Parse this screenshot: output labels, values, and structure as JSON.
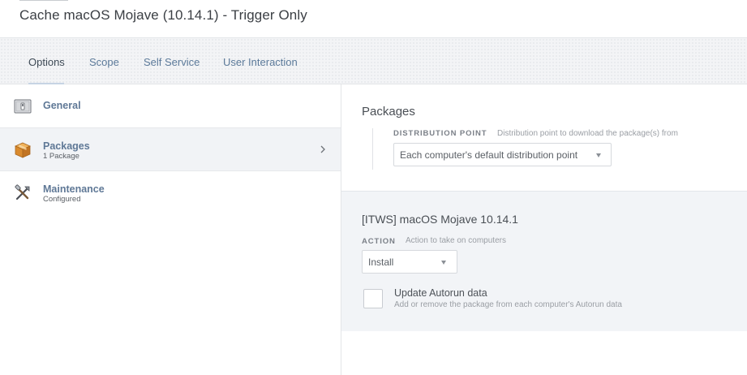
{
  "header": {
    "title": "Cache macOS Mojave (10.14.1) - Trigger Only"
  },
  "tabs": [
    {
      "label": "Options",
      "active": true
    },
    {
      "label": "Scope",
      "active": false
    },
    {
      "label": "Self Service",
      "active": false
    },
    {
      "label": "User Interaction",
      "active": false
    }
  ],
  "sidebar": {
    "items": [
      {
        "label": "General",
        "sublabel": "",
        "icon": "general-switch-icon"
      },
      {
        "label": "Packages",
        "sublabel": "1 Package",
        "icon": "package-box-icon",
        "selected": true
      },
      {
        "label": "Maintenance",
        "sublabel": "Configured",
        "icon": "tools-icon"
      }
    ]
  },
  "packages_section": {
    "title": "Packages",
    "distribution_point": {
      "label": "DISTRIBUTION POINT",
      "description": "Distribution point to download the package(s) from",
      "value": "Each computer's default distribution point"
    }
  },
  "package": {
    "name": "[ITWS] macOS Mojave 10.14.1",
    "action": {
      "label": "ACTION",
      "description": "Action to take on computers",
      "value": "Install"
    },
    "autorun": {
      "label": "Update Autorun data",
      "description": "Add or remove the package from each computer's Autorun data",
      "checked": false
    }
  },
  "colors": {
    "tab_link": "#5c7a9a",
    "accent_underline": "#c7d4e4",
    "sidebar_selected_bg": "#f1f3f6",
    "package_panel_bg": "#f2f4f7"
  }
}
